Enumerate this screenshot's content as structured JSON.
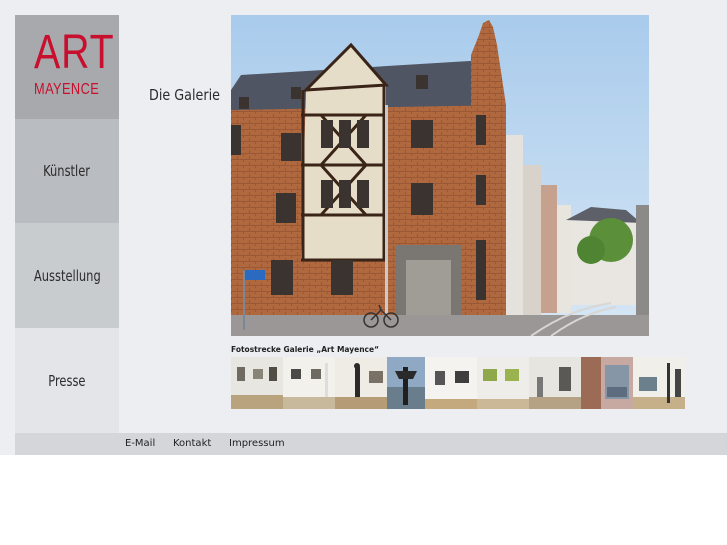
{
  "logo": {
    "primary": "ART",
    "secondary": "MAYENCE",
    "color": "#c8102e"
  },
  "nav": {
    "items": [
      {
        "label": "Künstler"
      },
      {
        "label": "Ausstellung"
      },
      {
        "label": "Presse"
      }
    ]
  },
  "main": {
    "heading": "Die Galerie",
    "caption": "Fotostrecke Galerie „Art Mayence“"
  },
  "gallery": {
    "thumbnail_count": 9
  },
  "footer": {
    "links": [
      {
        "label": "E-Mail"
      },
      {
        "label": "Kontakt"
      },
      {
        "label": "Impressum"
      }
    ]
  }
}
